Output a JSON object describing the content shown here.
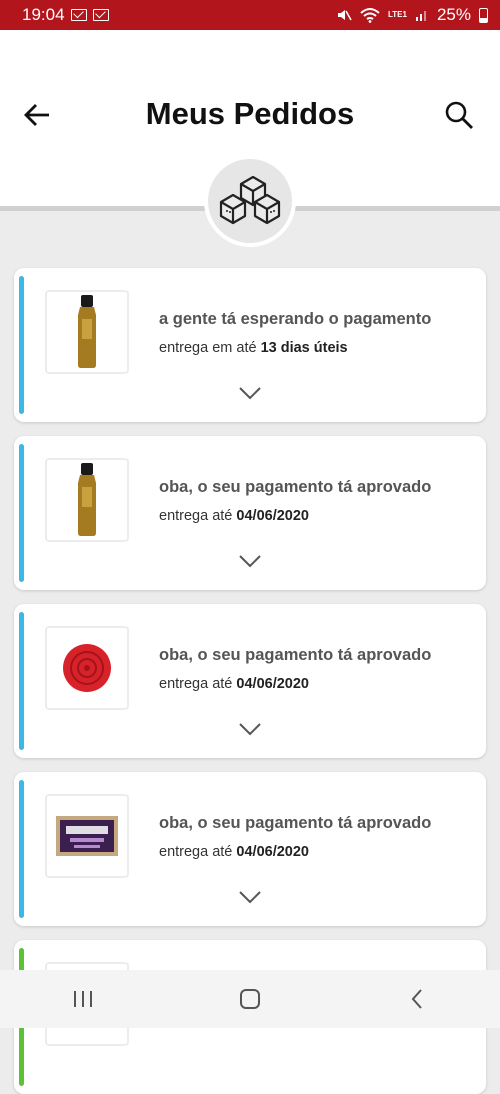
{
  "status_bar": {
    "time": "19:04",
    "battery": "25%",
    "network_label": "LTE1",
    "icons": [
      "mail-icon",
      "mail-icon",
      "mute-icon",
      "wifi-icon",
      "signal-icon",
      "battery-icon"
    ]
  },
  "header": {
    "title": "Meus Pedidos",
    "back_icon": "arrow-left-icon",
    "search_icon": "search-icon",
    "emblem_icon": "boxes-icon"
  },
  "colors": {
    "status_bar": "#b3151d",
    "accent_blue": "#3cb7e6",
    "accent_green": "#5bc236",
    "background": "#ececec"
  },
  "orders": [
    {
      "status": "a gente tá esperando o pagamento",
      "delivery_prefix": "entrega em até",
      "delivery_value": "13 dias úteis",
      "product_icon": "shampoo-bottle-icon",
      "accent": "#3cb7e6"
    },
    {
      "status": "oba, o seu pagamento tá aprovado",
      "delivery_prefix": "entrega até",
      "delivery_value": "04/06/2020",
      "product_icon": "shampoo-bottle-icon",
      "accent": "#3cb7e6"
    },
    {
      "status": "oba, o seu pagamento tá aprovado",
      "delivery_prefix": "entrega até",
      "delivery_value": "04/06/2020",
      "product_icon": "red-soap-icon",
      "accent": "#3cb7e6"
    },
    {
      "status": "oba, o seu pagamento tá aprovado",
      "delivery_prefix": "entrega até",
      "delivery_value": "04/06/2020",
      "product_icon": "soap-bar-package-icon",
      "accent": "#3cb7e6"
    },
    {
      "status": "",
      "delivery_prefix": "",
      "delivery_value": "",
      "product_icon": "product-icon",
      "accent": "#5bc236"
    }
  ],
  "nav_bar": {
    "icons": [
      "recent-apps-icon",
      "home-icon",
      "back-icon"
    ]
  }
}
